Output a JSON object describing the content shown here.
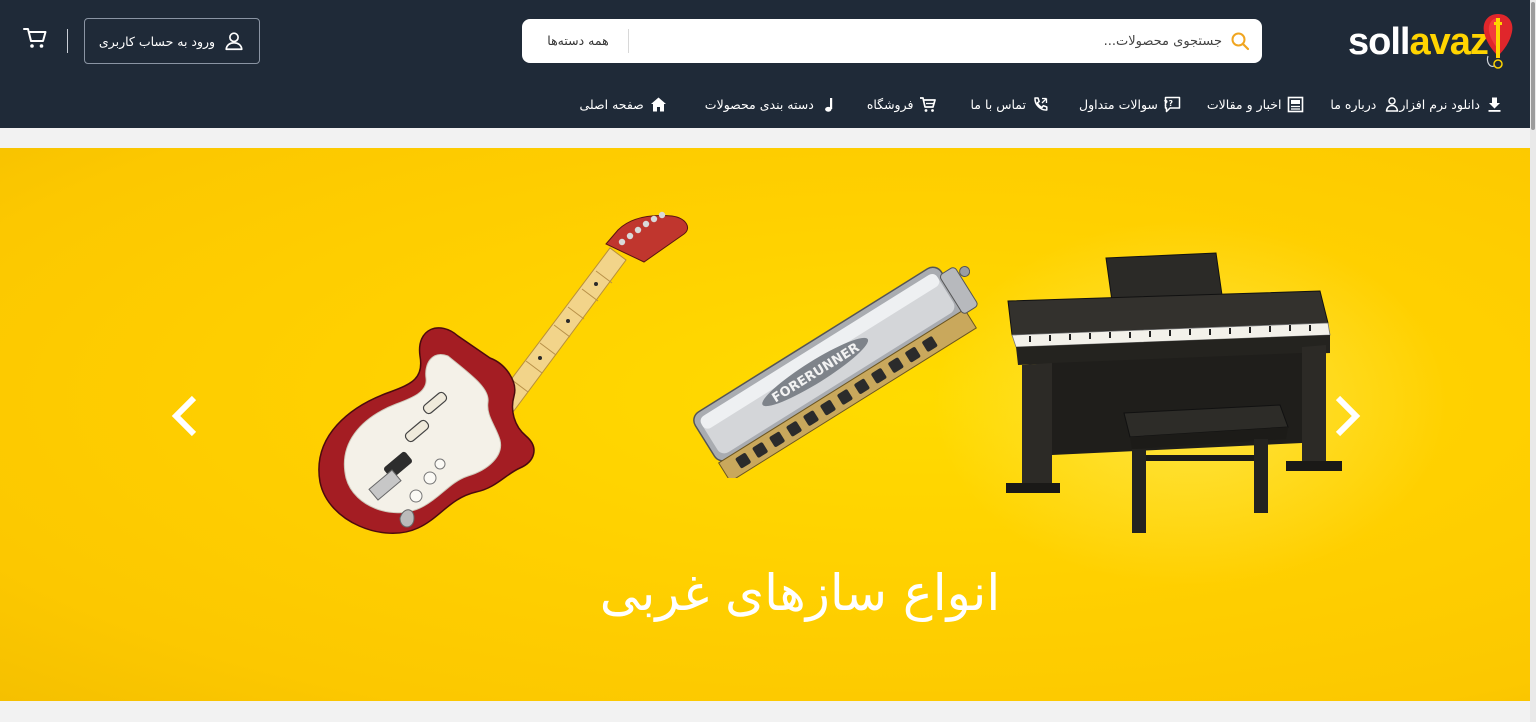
{
  "header": {
    "logo": {
      "text_white": "soll",
      "text_yellow": "avaz"
    },
    "search": {
      "placeholder": "جستجوی محصولات...",
      "category_label": "همه دسته‌ها"
    },
    "login_label": "ورود به حساب کاربری"
  },
  "nav": {
    "items": [
      {
        "label": "صفحه اصلی",
        "icon": "home-icon"
      },
      {
        "label": "دسته بندی محصولات",
        "icon": "music-note-icon"
      },
      {
        "label": "فروشگاه",
        "icon": "cart-icon"
      },
      {
        "label": "تماس با ما",
        "icon": "phone-icon"
      },
      {
        "label": "سوالات متداول",
        "icon": "faq-icon"
      },
      {
        "label": "اخبار و مقالات",
        "icon": "newspaper-icon"
      },
      {
        "label": "درباره ما",
        "icon": "user-question-icon"
      },
      {
        "label": "دانلود نرم افزار",
        "icon": "download-icon"
      }
    ]
  },
  "slider": {
    "caption": "انواع سازهای غربی",
    "harmonica_brand": "FORERUNNER"
  },
  "colors": {
    "header_bg": "#1f2a38",
    "accent_yellow": "#ffd400",
    "slide_bg": "#ffd000"
  }
}
